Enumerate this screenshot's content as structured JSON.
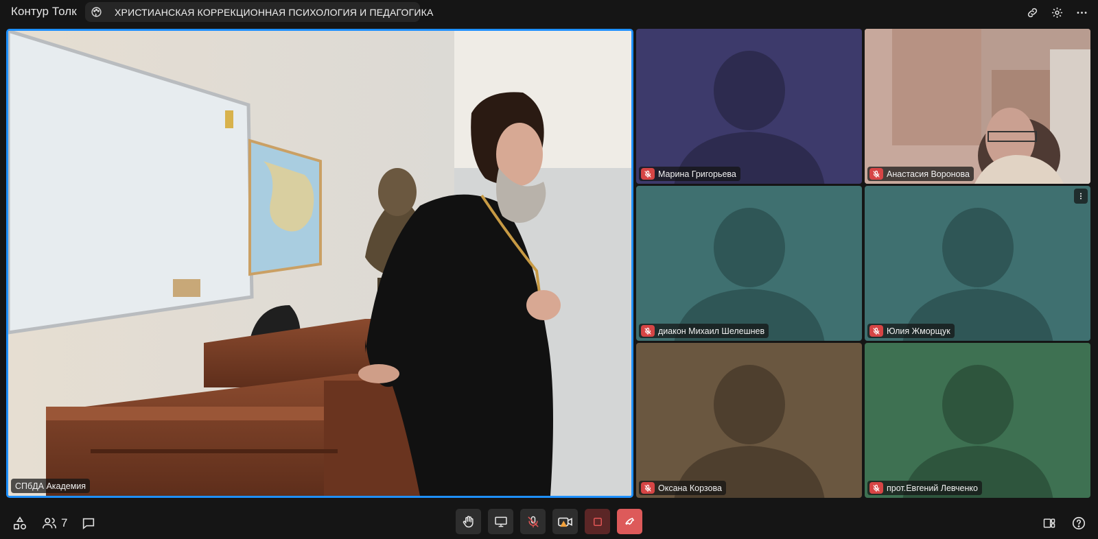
{
  "app": {
    "title": "Контур Толк"
  },
  "meeting": {
    "name": "ХРИСТИАНСКАЯ КОРРЕКЦИОННАЯ ПСИХОЛОГИЯ И ПЕДАГОГИКА"
  },
  "main_speaker": {
    "name": "СПбДА Академия"
  },
  "participants": [
    {
      "name": "Марина Григорьева",
      "muted": true,
      "bg": "#3d3a6b",
      "avatar": "#2d2b4f"
    },
    {
      "name": "Анастасия Воронова",
      "muted": true,
      "video": true
    },
    {
      "name": "диакон Михаил Шелешнев",
      "muted": true,
      "bg": "#3f7070",
      "avatar": "#2f5656"
    },
    {
      "name": "Юлия Жморщук",
      "muted": true,
      "bg": "#3f7070",
      "avatar": "#2f5656"
    },
    {
      "name": "Оксана Корзова",
      "muted": true,
      "bg": "#6a5740",
      "avatar": "#4e3f2e"
    },
    {
      "name": "прот.Евгений Левченко",
      "muted": true,
      "bg": "#3e7152",
      "avatar": "#2e553d"
    }
  ],
  "bottombar": {
    "participants_count": "7"
  },
  "colors": {
    "active_border": "#1e90ff",
    "mic_off": "#d64545",
    "hangup": "#dd5a5a"
  }
}
